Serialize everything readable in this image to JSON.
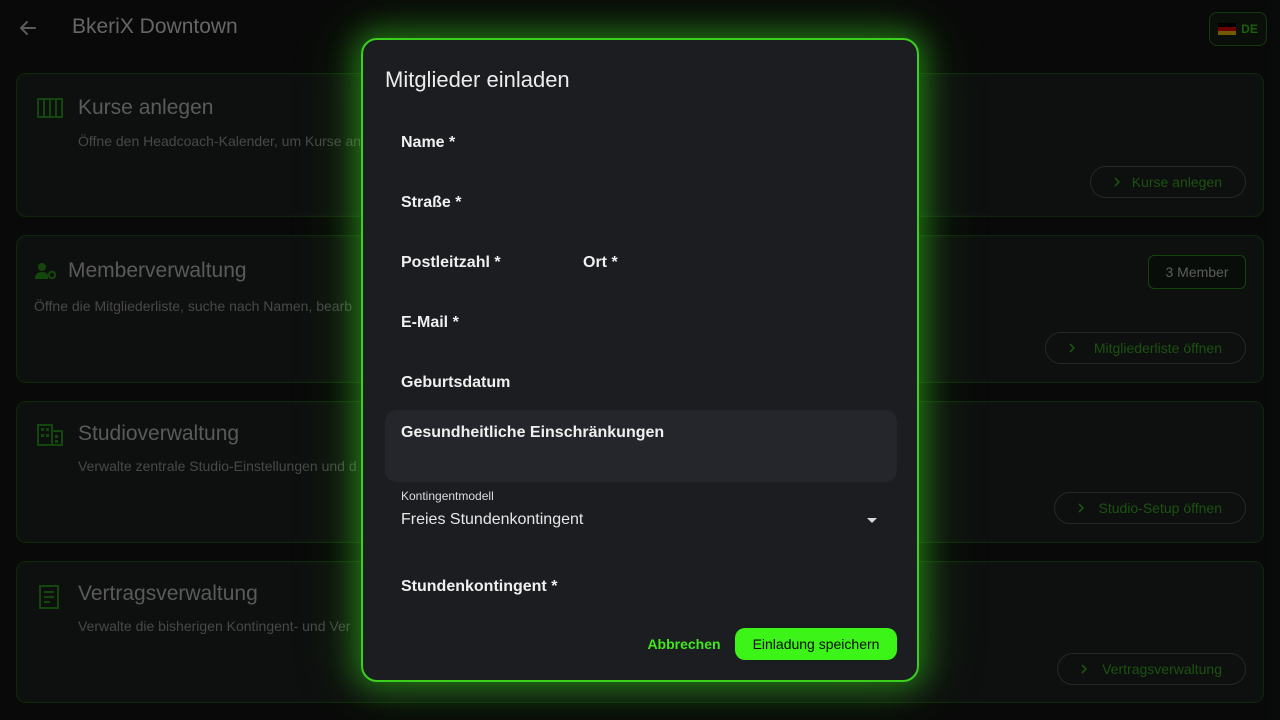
{
  "header": {
    "title": "BkeriX Downtown",
    "back_icon": "arrow-left-icon",
    "language": {
      "code": "DE",
      "flag": "flag-de-icon"
    }
  },
  "cards": [
    {
      "icon": "schedule-bars-icon",
      "title": "Kurse anlegen",
      "description": "Öffne den Headcoach-Kalender, um Kurse an",
      "button_label": "Kurse anlegen"
    },
    {
      "icon": "member-settings-icon",
      "title": "Memberverwaltung",
      "description": "Öffne die Mitgliederliste, suche nach Namen, bearb",
      "badge": "3 Member",
      "button_label": "Mitgliederliste öffnen"
    },
    {
      "icon": "building-icon",
      "title": "Studioverwaltung",
      "description": "Verwalte zentrale Studio-Einstellungen und d",
      "button_label": "Studio-Setup öffnen"
    },
    {
      "icon": "contract-icon",
      "title": "Vertragsverwaltung",
      "description": "Verwalte die bisherigen Kontingent- und Ver",
      "button_label": "Vertragsverwaltung"
    }
  ],
  "dialog": {
    "title": "Mitglieder einladen",
    "fields": {
      "name": {
        "label": "Name *",
        "value": ""
      },
      "street": {
        "label": "Straße *",
        "value": ""
      },
      "zip": {
        "label": "Postleitzahl *",
        "value": ""
      },
      "city": {
        "label": "Ort *",
        "value": ""
      },
      "email": {
        "label": "E-Mail *",
        "value": ""
      },
      "birthdate": {
        "label": "Geburtsdatum",
        "value": ""
      },
      "health": {
        "label": "Gesundheitliche Einschränkungen",
        "value": ""
      },
      "hours": {
        "label": "Stundenkontingent *",
        "value": ""
      }
    },
    "quota_model": {
      "label": "Kontingentmodell",
      "value": "Freies Stundenkontingent"
    },
    "actions": {
      "cancel": "Abbrechen",
      "save": "Einladung speichern"
    }
  },
  "colors": {
    "accent": "#3cf417",
    "accent_dim": "#2a7f18",
    "background": "#0e0f0f",
    "dialog_bg": "#1c1d21"
  }
}
